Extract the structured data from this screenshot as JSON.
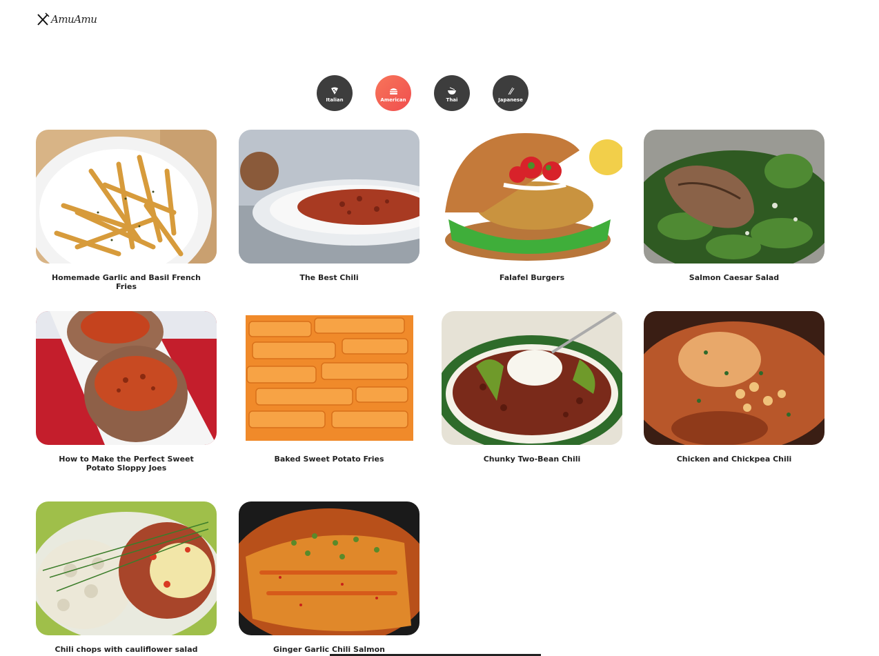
{
  "app": {
    "logo_text": "AmuAmu"
  },
  "cuisines": [
    {
      "label": "Italian",
      "icon": "pizza-icon",
      "active": false
    },
    {
      "label": "American",
      "icon": "burger-icon",
      "active": true
    },
    {
      "label": "Thai",
      "icon": "bowl-icon",
      "active": false
    },
    {
      "label": "Japanese",
      "icon": "chopsticks-icon",
      "active": false
    }
  ],
  "recipes": [
    {
      "title": "Homemade Garlic and Basil French Fries"
    },
    {
      "title": "The Best Chili"
    },
    {
      "title": "Falafel Burgers"
    },
    {
      "title": "Salmon Caesar Salad"
    },
    {
      "title": "How to Make the Perfect Sweet Potato Sloppy Joes"
    },
    {
      "title": "Baked Sweet Potato Fries"
    },
    {
      "title": "Chunky Two-Bean Chili"
    },
    {
      "title": "Chicken and Chickpea Chili"
    },
    {
      "title": "Chili chops with cauliflower salad"
    },
    {
      "title": "Ginger Garlic Chili Salmon"
    }
  ],
  "colors": {
    "accent": "#f26150",
    "chip": "#3d3d3d"
  }
}
